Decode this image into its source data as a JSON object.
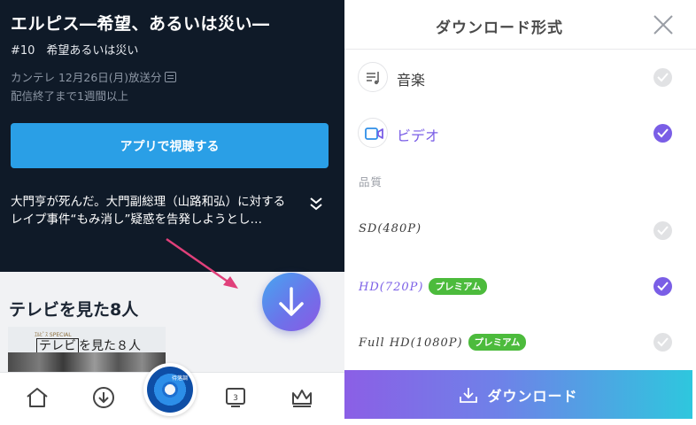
{
  "left": {
    "show_title": "エルピス―希望、あるいは災い―",
    "episode": "#10　希望あるいは災い",
    "broadcast": "カンテレ 12月26日(月)放送分",
    "expire": "配信終了まで1週間以上",
    "app_button": "アプリで視聴する",
    "synopsis_line1": "大門亨が死んだ。大門副総理（山路和弘）に対する",
    "synopsis_line2": "レイプ事件“もみ消し”疑惑を告発しようとし…",
    "section_title": "テレビを見た8人",
    "thumb_small": "ｴﾙﾋﾟｽ SPECIAL",
    "thumb_title_box": "テレビ",
    "thumb_title_rest": "を見た８人",
    "center_disc_label": "待落調",
    "nav_icons": [
      "home-icon",
      "download-icon",
      "music-disc",
      "tv-icon",
      "crown-icon"
    ],
    "nav_tv_number": "3"
  },
  "right": {
    "title": "ダウンロード形式",
    "options": [
      {
        "label": "音楽",
        "icon": "music-list-icon",
        "selected": false
      },
      {
        "label": "ビデオ",
        "icon": "video-camera-icon",
        "selected": true
      }
    ],
    "quality_heading": "品質",
    "qualities": [
      {
        "label": "SD(480P)",
        "badge": "",
        "selected": false
      },
      {
        "label": "HD(720P)",
        "badge": "プレミアム",
        "selected": true
      },
      {
        "label": "Full HD(1080P)",
        "badge": "プレミアム",
        "selected": false
      }
    ],
    "download_button": "ダウンロード"
  },
  "colors": {
    "accent_purple": "#7a5ee6",
    "left_bg": "#0f1a28",
    "app_button": "#2a9fe6",
    "premium_badge": "#4cbb3c",
    "arrow_annotation": "#e0407a"
  }
}
